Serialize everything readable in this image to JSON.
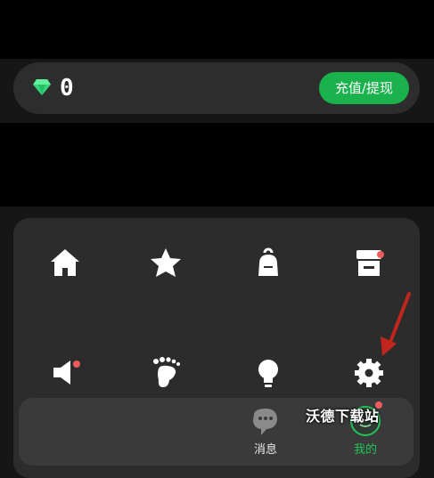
{
  "wallet": {
    "balance": "0",
    "recharge_label": "充值/提现"
  },
  "menu": {
    "items": [
      {
        "icon": "home-icon",
        "badge": false
      },
      {
        "icon": "star-icon",
        "badge": false
      },
      {
        "icon": "backpack-icon",
        "badge": false
      },
      {
        "icon": "shop-icon",
        "badge": true
      },
      {
        "icon": "speaker-icon",
        "badge": true
      },
      {
        "icon": "footprint-icon",
        "badge": false
      },
      {
        "icon": "lightbulb-icon",
        "badge": false
      },
      {
        "icon": "gear-icon",
        "badge": false
      }
    ]
  },
  "tabs": {
    "messages": "消息",
    "mine": "我的"
  },
  "watermark": "沃德下载站",
  "colors": {
    "accent_green": "#19b24d",
    "badge_red": "#ef5a5a",
    "arrow_red": "#c0261d"
  }
}
